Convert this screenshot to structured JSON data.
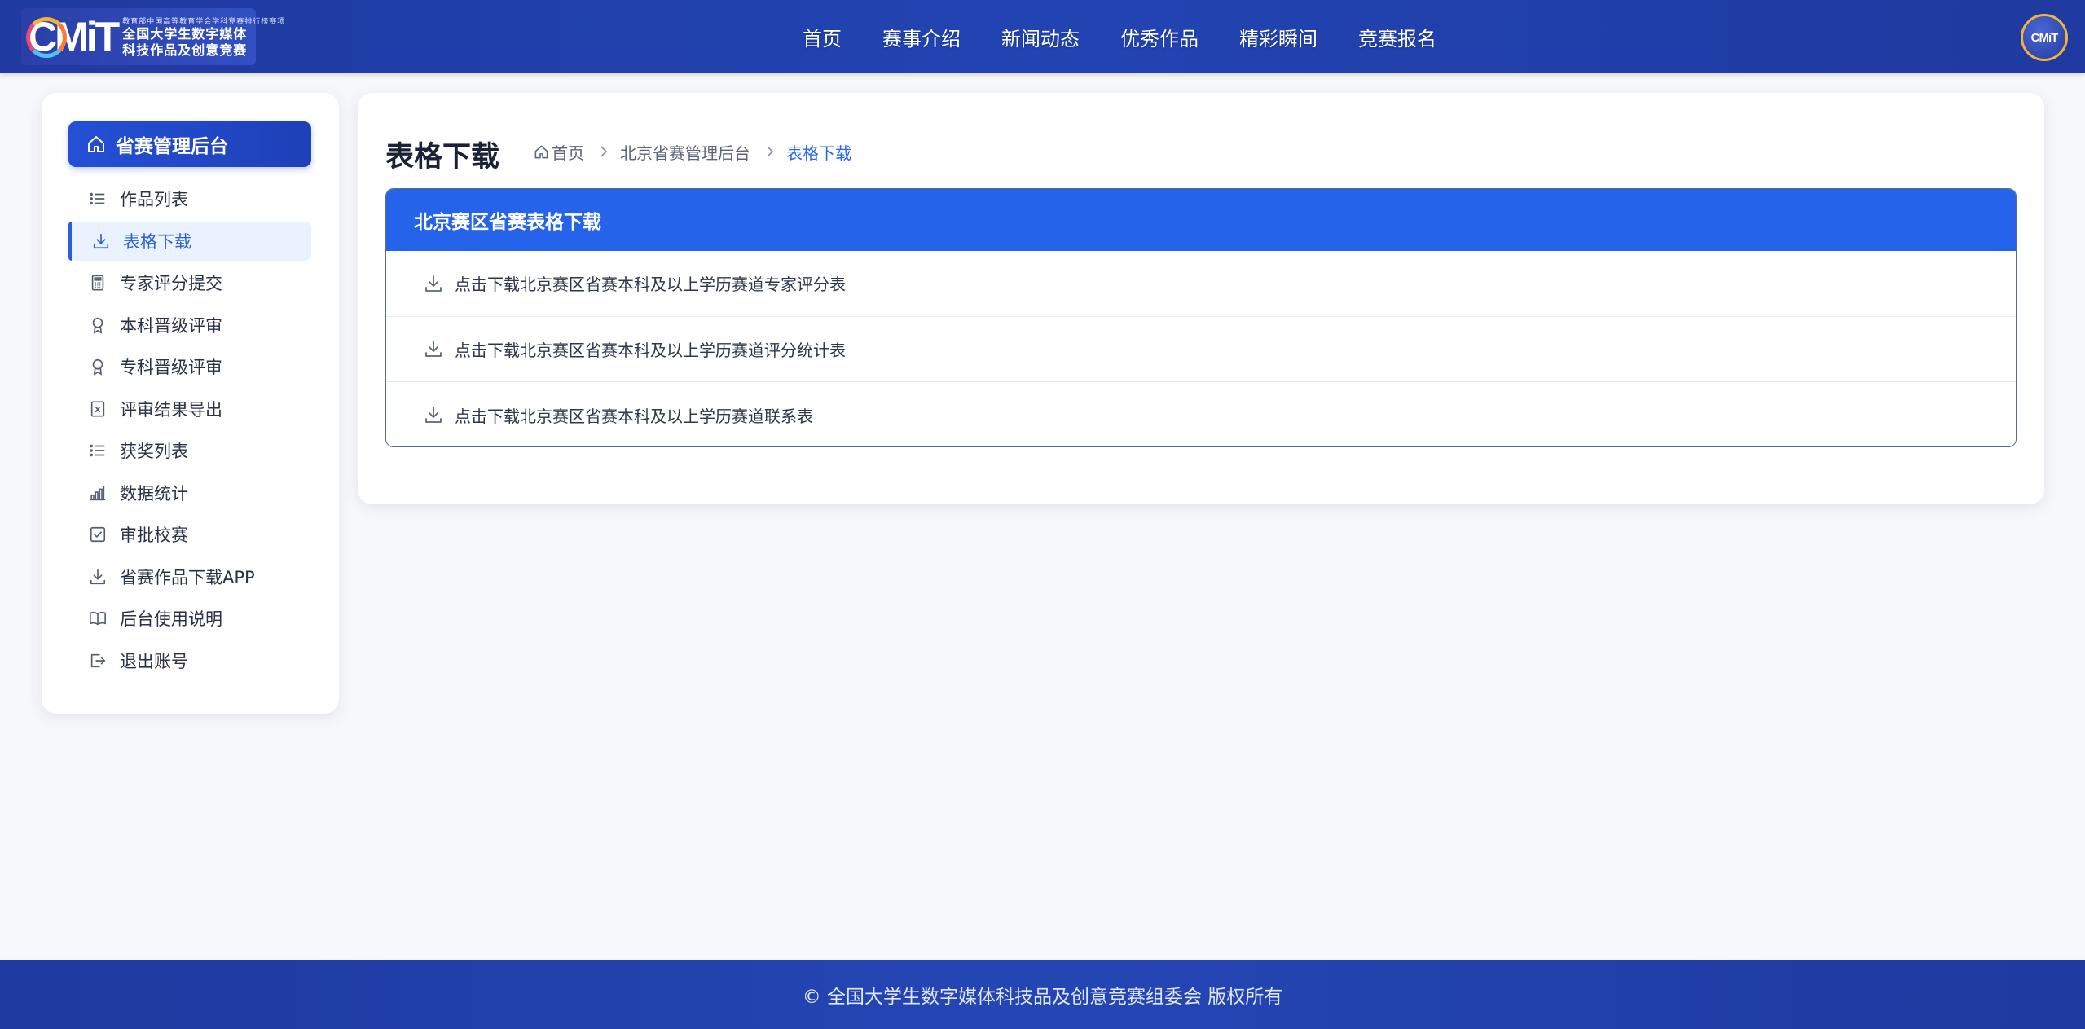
{
  "header": {
    "logo": {
      "mark": "CMiT",
      "small_text": "教育部中国高等教育学会学科竞赛排行榜赛项",
      "line1": "全国大学生数字媒体",
      "line2": "科技作品及创意竞赛"
    },
    "nav": [
      "首页",
      "赛事介绍",
      "新闻动态",
      "优秀作品",
      "精彩瞬间",
      "竞赛报名"
    ],
    "avatar_text": "CMiT",
    "brand_color": "#2244b3"
  },
  "sidebar": {
    "title": "省赛管理后台",
    "title_icon": "home-icon",
    "items": [
      {
        "label": "作品列表",
        "icon": "list-icon"
      },
      {
        "label": "表格下载",
        "icon": "download-icon",
        "active": true
      },
      {
        "label": "专家评分提交",
        "icon": "calculator-icon"
      },
      {
        "label": "本科晋级评审",
        "icon": "award-icon"
      },
      {
        "label": "专科晋级评审",
        "icon": "award-icon"
      },
      {
        "label": "评审结果导出",
        "icon": "excel-file-icon"
      },
      {
        "label": "获奖列表",
        "icon": "list-icon"
      },
      {
        "label": "数据统计",
        "icon": "bar-chart-icon"
      },
      {
        "label": "审批校赛",
        "icon": "checkbox-icon"
      },
      {
        "label": "省赛作品下载APP",
        "icon": "download-icon"
      },
      {
        "label": "后台使用说明",
        "icon": "book-icon"
      },
      {
        "label": "退出账号",
        "icon": "logout-icon"
      }
    ]
  },
  "main": {
    "title": "表格下载",
    "breadcrumb": [
      "首页",
      "北京省赛管理后台",
      "表格下载"
    ],
    "panel": {
      "title": "北京赛区省赛表格下载",
      "header_color": "#2563eb",
      "downloads": [
        "点击下载北京赛区省赛本科及以上学历赛道专家评分表",
        "点击下载北京赛区省赛本科及以上学历赛道评分统计表",
        "点击下载北京赛区省赛本科及以上学历赛道联系表"
      ]
    }
  },
  "footer": {
    "copyright": "© 全国大学生数字媒体科技品及创意竞赛组委会 版权所有"
  }
}
